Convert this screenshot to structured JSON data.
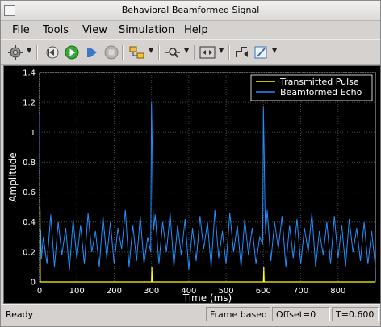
{
  "window": {
    "title": "Behavioral  Beamformed Signal"
  },
  "menu": {
    "items": [
      "File",
      "Tools",
      "View",
      "Simulation",
      "Help"
    ]
  },
  "toolbar": {
    "icons": [
      "gear-icon",
      "restore-icon",
      "run-icon",
      "step-forward-icon",
      "stop-icon",
      "highlight-block-icon",
      "zoom-icon",
      "fit-axes-icon",
      "signal-icon",
      "style-icon"
    ]
  },
  "status": {
    "ready": "Ready",
    "frame": "Frame based",
    "offset": "Offset=0",
    "time": "T=0.600"
  },
  "colors": {
    "background": "#000000",
    "pulse": "#ffff00",
    "echo": "#1e90ff",
    "grid": "#444444",
    "axis_text": "#ffffff"
  },
  "chart_data": {
    "type": "line",
    "xlabel": "Time (ms)",
    "ylabel": "Amplitude",
    "xlim": [
      0,
      900
    ],
    "ylim": [
      0,
      1.4
    ],
    "xticks": [
      0,
      100,
      200,
      300,
      400,
      500,
      600,
      700,
      800
    ],
    "yticks": [
      0,
      0.2,
      0.4,
      0.6,
      0.8,
      1,
      1.2,
      1.4
    ],
    "grid": true,
    "legend_position": "top-right",
    "series": [
      {
        "name": "Transmitted Pulse",
        "color": "#ffff00",
        "x": [
          0,
          1,
          2,
          3,
          300,
          301,
          302,
          303,
          600,
          601,
          602,
          603,
          900
        ],
        "y": [
          0.5,
          0.48,
          0.0,
          0.0,
          0.0,
          0.1,
          0.0,
          0.0,
          0.0,
          0.1,
          0.0,
          0.0,
          0.0
        ]
      },
      {
        "name": "Beamformed Echo",
        "color": "#1e90ff",
        "x": [
          0,
          1,
          2,
          3,
          5,
          10,
          20,
          30,
          40,
          50,
          60,
          70,
          80,
          90,
          100,
          110,
          120,
          130,
          140,
          150,
          160,
          170,
          180,
          190,
          200,
          210,
          220,
          230,
          240,
          250,
          260,
          270,
          280,
          290,
          298,
          300,
          302,
          304,
          306,
          310,
          320,
          330,
          340,
          350,
          360,
          370,
          380,
          390,
          400,
          410,
          420,
          430,
          440,
          450,
          460,
          470,
          480,
          490,
          500,
          510,
          520,
          530,
          540,
          550,
          560,
          570,
          580,
          590,
          598,
          600,
          602,
          604,
          606,
          610,
          620,
          630,
          640,
          650,
          660,
          670,
          680,
          690,
          700,
          710,
          720,
          730,
          740,
          750,
          760,
          770,
          780,
          790,
          800,
          810,
          820,
          830,
          840,
          850,
          860,
          870,
          880,
          890,
          900
        ],
        "y": [
          1.12,
          0.6,
          0.2,
          0.35,
          0.15,
          0.3,
          0.12,
          0.45,
          0.1,
          0.4,
          0.18,
          0.36,
          0.08,
          0.42,
          0.15,
          0.38,
          0.12,
          0.46,
          0.2,
          0.34,
          0.1,
          0.44,
          0.16,
          0.4,
          0.12,
          0.36,
          0.22,
          0.48,
          0.1,
          0.38,
          0.14,
          0.44,
          0.12,
          0.3,
          0.2,
          1.2,
          0.9,
          0.5,
          0.35,
          0.45,
          0.12,
          0.4,
          0.2,
          0.46,
          0.1,
          0.38,
          0.18,
          0.42,
          0.08,
          0.36,
          0.14,
          0.44,
          0.22,
          0.4,
          0.1,
          0.48,
          0.16,
          0.34,
          0.12,
          0.46,
          0.2,
          0.38,
          0.1,
          0.42,
          0.18,
          0.36,
          0.12,
          0.3,
          0.25,
          1.17,
          0.85,
          0.5,
          0.32,
          0.48,
          0.14,
          0.4,
          0.22,
          0.44,
          0.1,
          0.38,
          0.16,
          0.42,
          0.12,
          0.36,
          0.2,
          0.46,
          0.1,
          0.34,
          0.18,
          0.4,
          0.12,
          0.44,
          0.16,
          0.38,
          0.1,
          0.42,
          0.2,
          0.36,
          0.14,
          0.4,
          0.12,
          0.34,
          0.1
        ]
      }
    ]
  }
}
